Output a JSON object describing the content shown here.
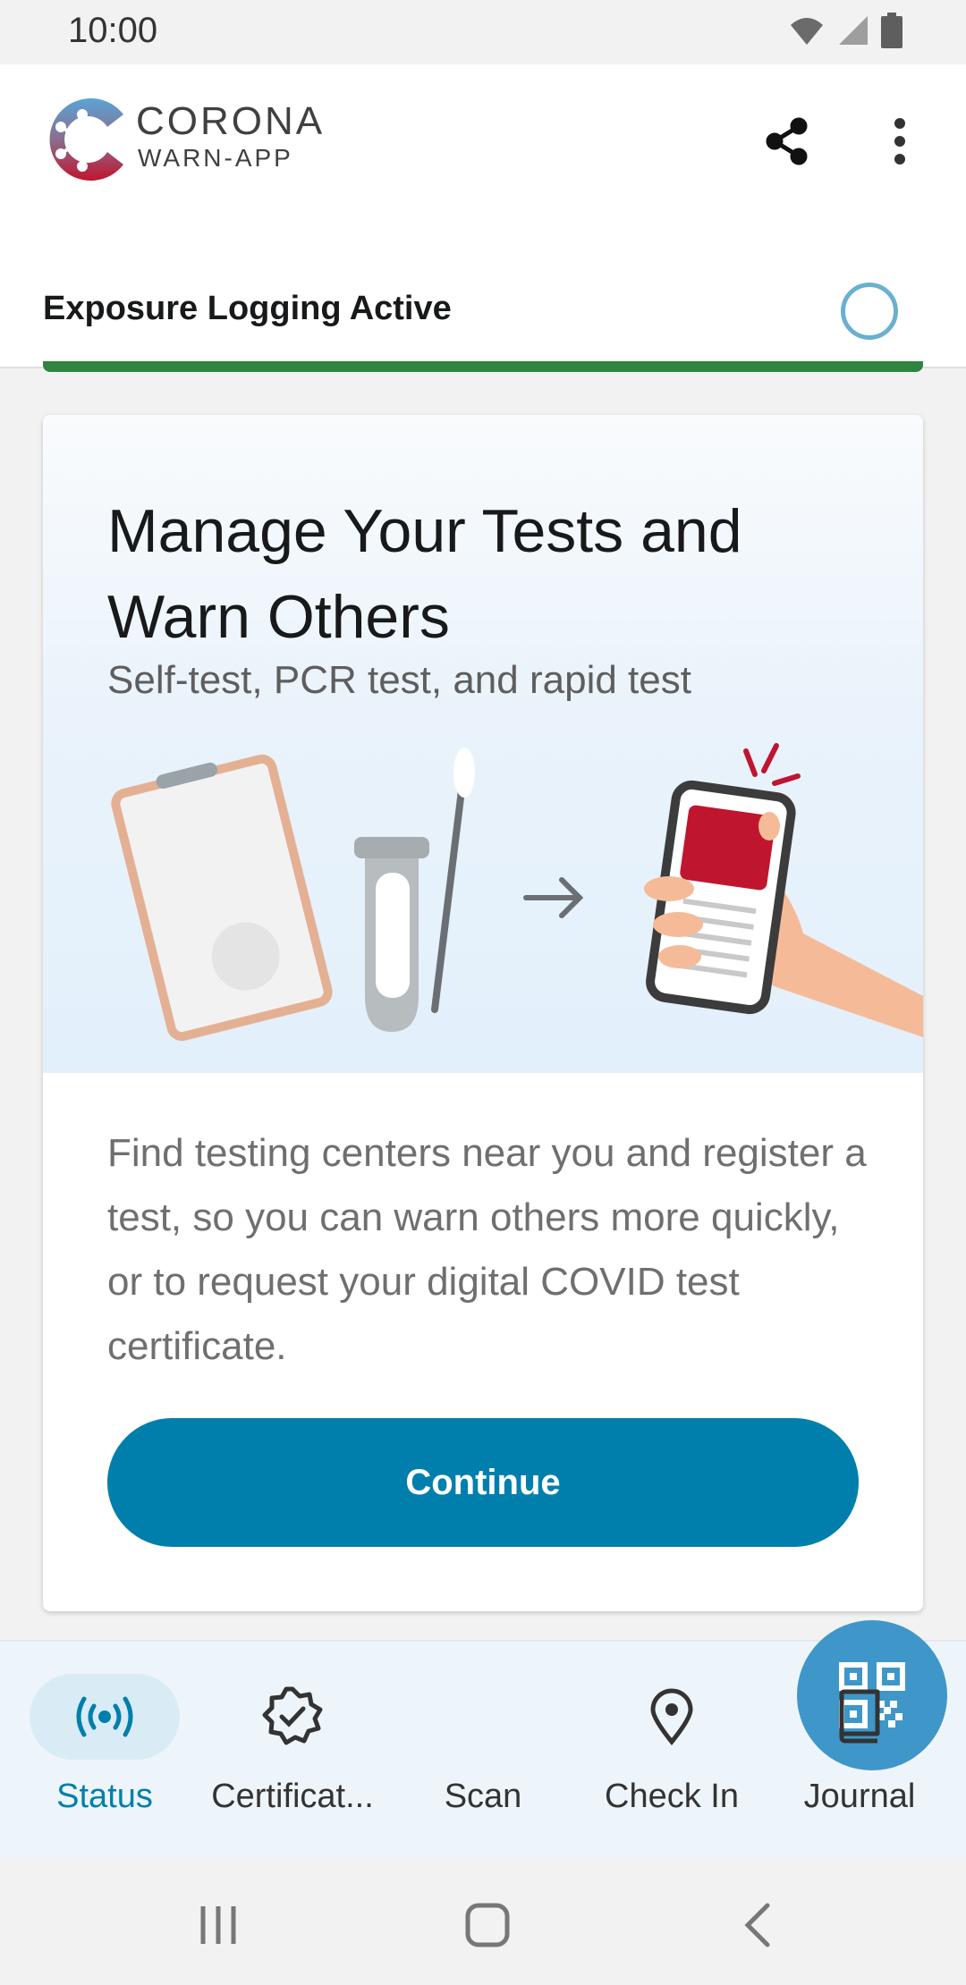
{
  "status_bar": {
    "time": "10:00",
    "icons": [
      "wifi-icon",
      "signal-icon",
      "battery-icon"
    ]
  },
  "header": {
    "logo_line1": "CORONA",
    "logo_line2": "WARN-APP",
    "share_icon": "share-icon",
    "more_icon": "more-vert-icon",
    "exposure_status": "Exposure Logging Active"
  },
  "card": {
    "title": "Manage Your Tests and Warn Others",
    "subtitle": "Self-test, PCR test, and rapid test",
    "body": "Find testing centers near you and register a test, so you can warn others more quickly, or to request your digital COVID test certificate.",
    "button_label": "Continue"
  },
  "bottom_nav": {
    "items": [
      {
        "label": "Status",
        "icon": "broadcast-icon",
        "active": true
      },
      {
        "label": "Certificat...",
        "icon": "certificate-icon",
        "active": false
      },
      {
        "label": "Scan",
        "icon": "qr-code-icon",
        "active": false
      },
      {
        "label": "Check In",
        "icon": "location-pin-icon",
        "active": false
      },
      {
        "label": "Journal",
        "icon": "book-icon",
        "active": false
      }
    ]
  },
  "system_nav": [
    "recents-icon",
    "home-icon",
    "back-icon"
  ],
  "colors": {
    "accent": "#007fad",
    "active_green": "#2e8540",
    "logo_red": "#c0152f",
    "logo_blue": "#5aa4d4"
  }
}
